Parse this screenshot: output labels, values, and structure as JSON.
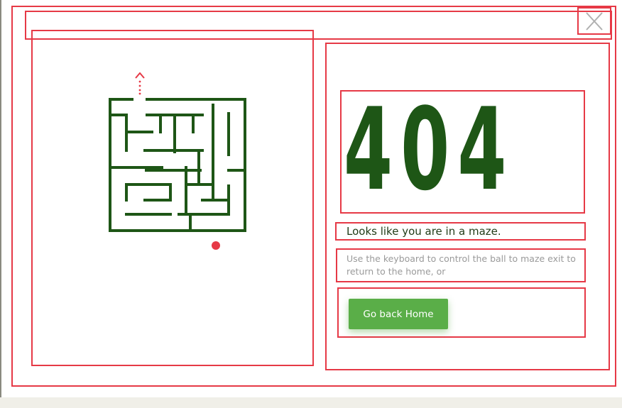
{
  "error": {
    "code": "404",
    "heading": "Looks like you are in a maze.",
    "description": "Use the keyboard to control the ball to maze exit to return to the home, or"
  },
  "actions": {
    "home_button_label": "Go back Home"
  },
  "icons": {
    "close": "close-icon",
    "exit_arrow": "arrow-up-icon",
    "ball": "ball-icon"
  },
  "colors": {
    "maze_walls": "#1e5616",
    "code_text": "#1e5616",
    "heading_text": "#1f3b16",
    "description_text": "#9a9a9a",
    "button_bg": "#5aae48",
    "ball": "#e63946",
    "outline": "#e63946"
  }
}
